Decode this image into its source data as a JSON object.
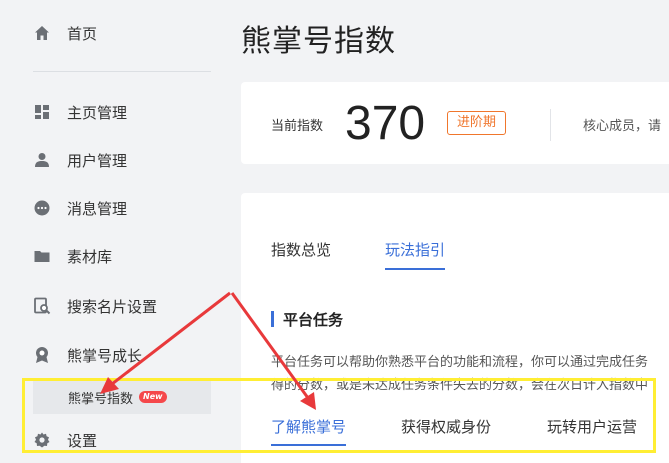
{
  "sidebar": {
    "items": [
      {
        "label": "首页",
        "icon": "home-icon"
      },
      {
        "label": "主页管理",
        "icon": "grid-icon"
      },
      {
        "label": "用户管理",
        "icon": "user-icon"
      },
      {
        "label": "消息管理",
        "icon": "message-icon"
      },
      {
        "label": "素材库",
        "icon": "folder-icon"
      },
      {
        "label": "搜索名片设置",
        "icon": "search-card-icon"
      },
      {
        "label": "熊掌号成长",
        "icon": "badge-icon"
      },
      {
        "label": "设置",
        "icon": "gear-icon"
      }
    ],
    "sub_item": {
      "label": "熊掌号指数",
      "badge": "New"
    }
  },
  "main": {
    "title": "熊掌号指数",
    "index_card": {
      "label": "当前指数",
      "value": "370",
      "stage": "进阶期",
      "core_text": "核心成员，请"
    },
    "tabs": [
      {
        "label": "指数总览",
        "active": false
      },
      {
        "label": "玩法指引",
        "active": true
      }
    ],
    "section": {
      "title": "平台任务",
      "desc_line1": "平台任务可以帮助你熟悉平台的功能和流程，你可以通过完成任务",
      "desc_line2": "得的分数，或是未达成任务条件失去的分数，会在次日计入指数中"
    },
    "sub_tabs": [
      {
        "label": "了解熊掌号",
        "active": true
      },
      {
        "label": "获得权威身份",
        "active": false
      },
      {
        "label": "玩转用户运营",
        "active": false
      }
    ]
  },
  "colors": {
    "accent": "#3a6fd8",
    "stage": "#f0762c",
    "annotation_arrow": "#e8393b",
    "annotation_box": "#ffee34"
  }
}
